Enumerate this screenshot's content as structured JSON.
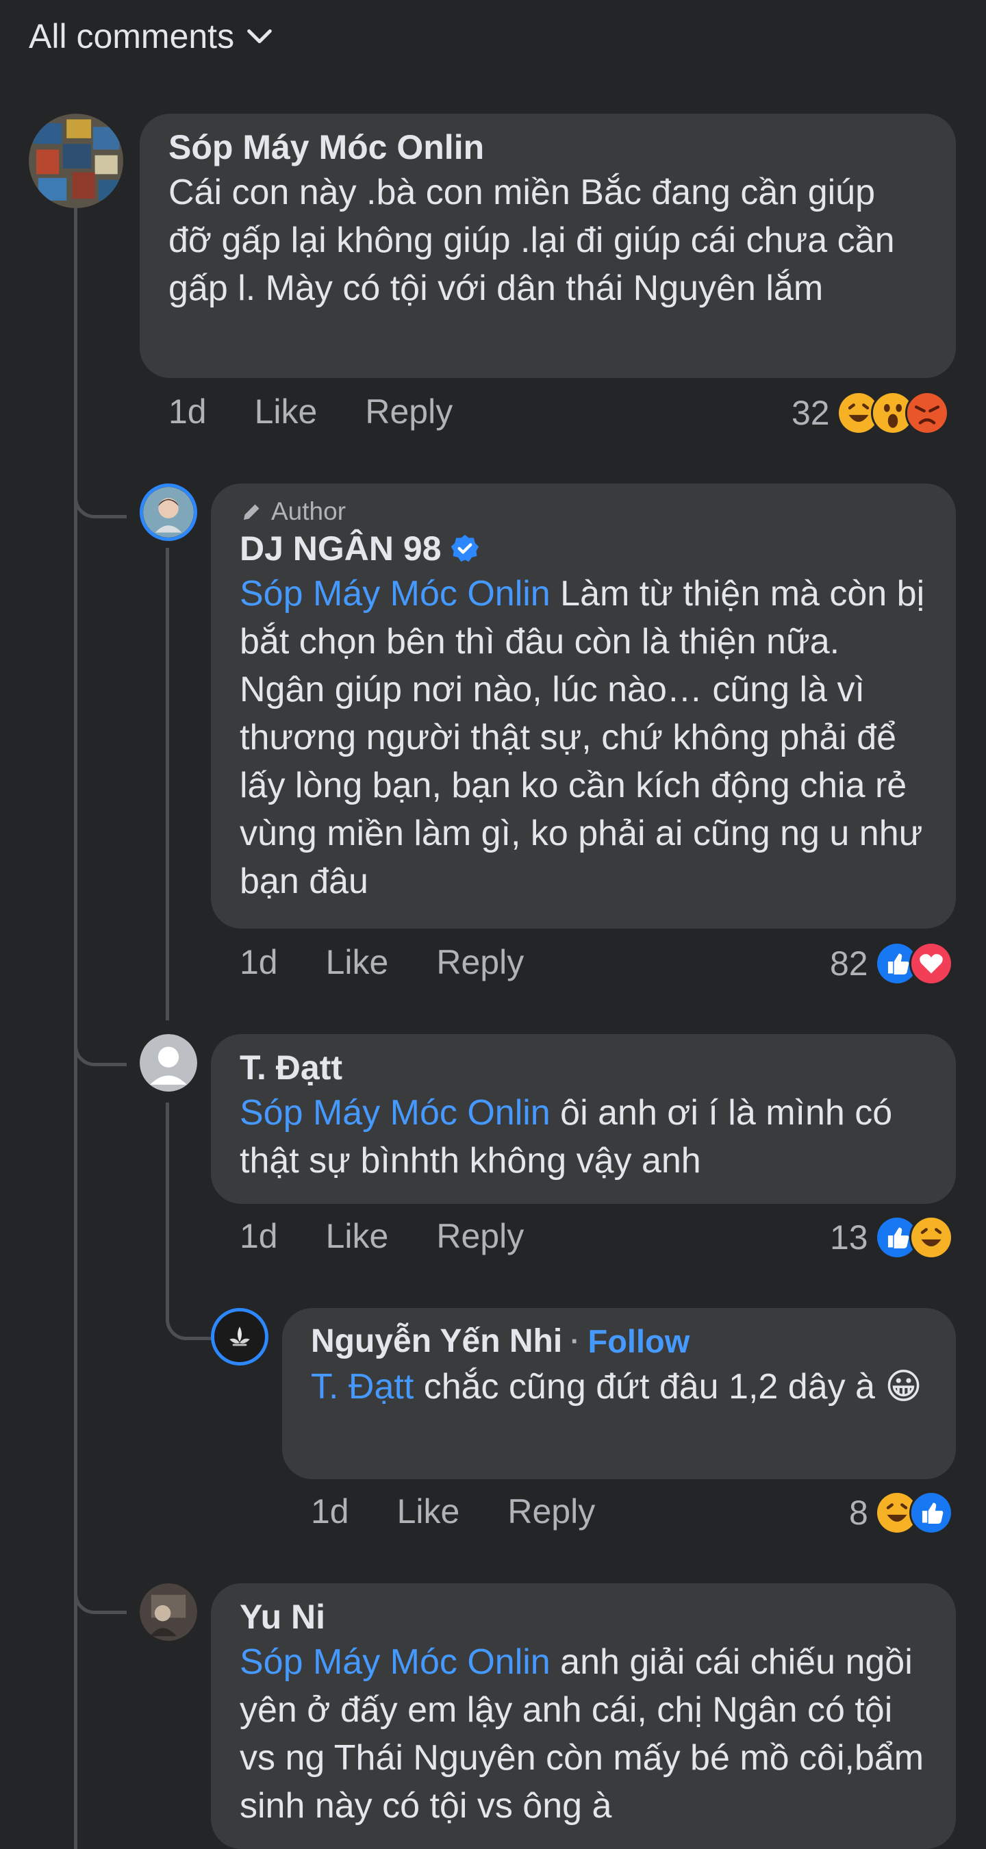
{
  "header": {
    "sort_label": "All comments"
  },
  "comments": [
    {
      "author": "Sóp Máy Móc Onlin",
      "text": "Cái con này .bà con miền Bắc  đang cần giúp đỡ gấp  lại không giúp .lại đi giúp cái chưa cần gấp  l. Mày có tội với dân thái Nguyên lắm",
      "time": "1d",
      "like": "Like",
      "reply": "Reply",
      "reaction_count": "32",
      "reactions": [
        "haha-icon",
        "wow-icon",
        "angry-icon"
      ]
    },
    {
      "badge": "Author",
      "author": "DJ NGÂN 98",
      "mention": "Sóp Máy Móc Onlin",
      "text": " Làm từ thiện mà còn bị bắt chọn bên thì đâu còn là thiện nữa. Ngân giúp nơi nào, lúc nào… cũng là vì thương người thật sự, chứ không phải để lấy lòng bạn, bạn ko cần kích động chia rẻ vùng miền làm gì, ko phải ai cũng ng u như bạn đâu",
      "time": "1d",
      "like": "Like",
      "reply": "Reply",
      "reaction_count": "82",
      "reactions": [
        "like-icon",
        "love-icon"
      ]
    },
    {
      "author": "T. Đạtt",
      "mention": "Sóp Máy Móc Onlin",
      "text": " ôi anh ơi í là mình có thật sự bìnhth không vậy anh",
      "time": "1d",
      "like": "Like",
      "reply": "Reply",
      "reaction_count": "13",
      "reactions": [
        "like-icon",
        "haha-icon"
      ]
    },
    {
      "author": "Nguyễn Yến Nhi",
      "separator": "·",
      "follow": "Follow",
      "mention": "T. Đạtt",
      "text": " chắc cũng đứt đâu 1,2 dây à 😀",
      "time": "1d",
      "like": "Like",
      "reply": "Reply",
      "reaction_count": "8",
      "reactions": [
        "haha-icon",
        "like-icon"
      ]
    },
    {
      "author": "Yu Ni",
      "mention": "Sóp Máy Móc Onlin",
      "text": " anh giải cái chiếu ngồi yên ở đấy em lậy anh cái, chị Ngân có tội vs ng Thái Nguyên còn mấy bé mồ côi,bẩm sinh này có tội vs ông à"
    }
  ],
  "colors": {
    "background": "#242526",
    "bubble": "#3a3b3c",
    "mention": "#4599ff",
    "verified": "#2d88ff"
  }
}
